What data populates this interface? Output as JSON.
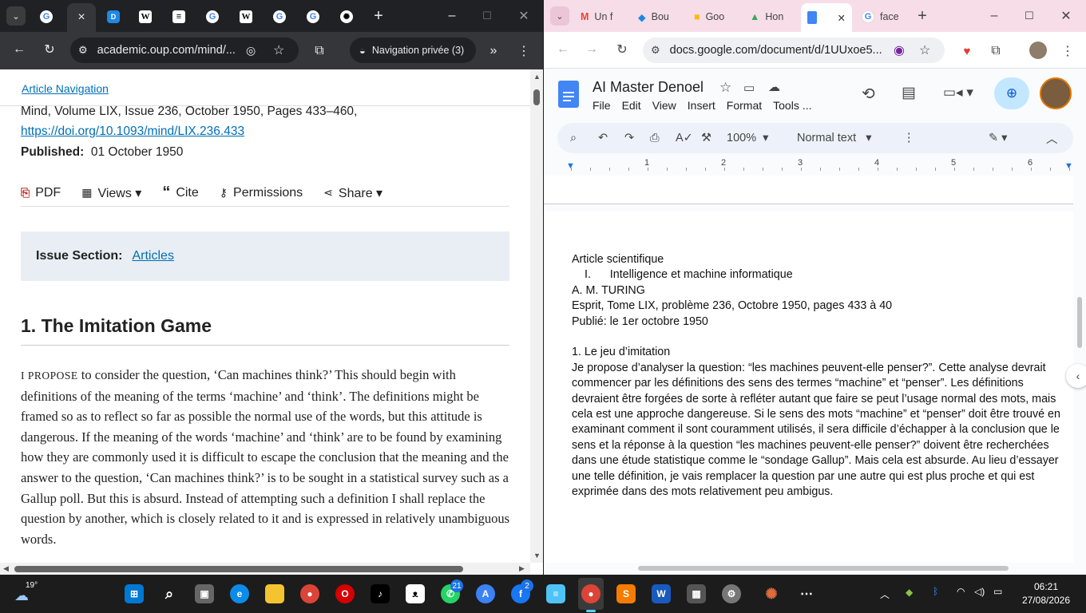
{
  "left_browser": {
    "favicons": [
      "G",
      "×",
      "D",
      "W",
      "≡",
      "G",
      "W",
      "G",
      "G",
      "✺"
    ],
    "url": "academic.oup.com/mind/...",
    "private_label": "Navigation privée (3)",
    "article_nav": "Article Navigation",
    "meta_line1": "Mind, Volume LIX, Issue 236, October 1950, Pages 433–460,",
    "doi": "https://doi.org/10.1093/mind/LIX.236.433",
    "published_label": "Published:",
    "published_date": "01 October 1950",
    "actions": {
      "pdf": "PDF",
      "views": "Views ▾",
      "cite": "Cite",
      "permissions": "Permissions",
      "share": "Share ▾"
    },
    "issue_label": "Issue Section:",
    "issue_value": "Articles",
    "heading": "1. The Imitation Game",
    "lead_word": "I PROPOSE",
    "paragraph": "to consider the question, ‘Can machines think?’ This should begin with definitions of the meaning of the terms ‘machine’ and ‘think’. The definitions might be framed so as to reflect so far as possible the normal use of the words, but this attitude is dangerous. If the meaning of the words ‘machine’ and ‘think’ are to be found by examining how they are commonly used it is difficult to escape the conclusion that the meaning and the answer to the question, ‘Can machines think?’ is to be sought in a statistical survey such as a Gallup poll. But this is absurd. Instead of attempting such a definition I shall replace the question by another, which is closely related to it and is expressed in relatively unambiguous words."
  },
  "right_browser": {
    "tabs": [
      "Un f",
      "Bou",
      "Goo",
      "Hon",
      "",
      "face"
    ],
    "url": "docs.google.com/document/d/1UUxoe5...",
    "doc_title": "AI Master Denoel",
    "menu": [
      "File",
      "Edit",
      "View",
      "Insert",
      "Format",
      "Tools",
      "..."
    ],
    "zoom": "100%",
    "style": "Normal text",
    "ruler_numbers": [
      "1",
      "2",
      "3",
      "4",
      "5",
      "6"
    ],
    "doc_lines": [
      "Article scientifique",
      "I.      Intelligence et machine informatique",
      "A. M. TURING",
      "Esprit, Tome LIX, problème 236, Octobre 1950, pages 433 à 40",
      "Publié: le 1er octobre 1950",
      "",
      "1. Le jeu d’imitation"
    ],
    "doc_paragraph": "Je propose d’analyser la question: “les machines peuvent-elle penser?”. Cette analyse devrait commencer par les définitions des sens des termes “machine” et “penser”. Les définitions devraient être forgées de sorte à refléter autant que faire se peut l’usage normal des mots, mais cela est une approche dangereuse. Si le sens des mots “machine” et “penser” doit être trouvé en examinant comment il sont couramment utilisés, il sera difficile d’échapper à la conclusion que le sens et la réponse à la question “les machines peuvent-elle penser?” doivent être recherchées dans une étude statistique comme le “sondage Gallup”. Mais cela est absurde. Au lieu d’essayer une telle définition, je vais remplacer la question par une autre qui est plus proche et qui est exprimée dans des mots relativement peu ambigus."
  },
  "taskbar": {
    "weather": "19°",
    "badge_whatsapp": "21",
    "badge_msg": "2",
    "time": "06:21",
    "date": "27/08/2026"
  }
}
